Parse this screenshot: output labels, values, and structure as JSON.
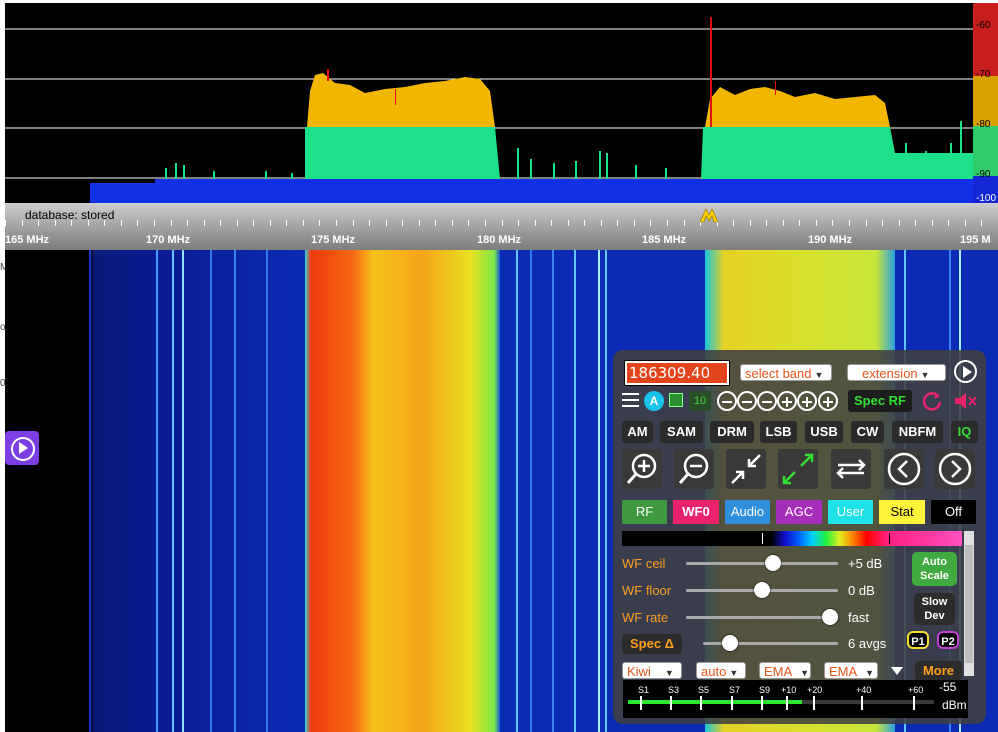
{
  "spectrum": {
    "db_labels": [
      "-60",
      "-70",
      "-80",
      "-90",
      "-100"
    ],
    "db_colors": [
      "#c81e1e",
      "#d8a000",
      "#d8c400",
      "#2ecc6a",
      "#1428d8"
    ]
  },
  "scale": {
    "database_status": "database: stored",
    "freq_labels": [
      "165 MHz",
      "170 MHz",
      "175 MHz",
      "180 MHz",
      "185 MHz",
      "190 MHz",
      "195 M"
    ]
  },
  "left_strip": {
    "glyphs": [
      "M",
      "o",
      "0"
    ]
  },
  "panel": {
    "frequency": "186309.40",
    "band_select": "select band",
    "extension_select": "extension",
    "auto_badge": "A",
    "step_badge": "10",
    "spec_rf": "Spec RF",
    "modes": [
      "AM",
      "SAM",
      "DRM",
      "LSB",
      "USB",
      "CW",
      "NBFM",
      "IQ"
    ],
    "tabs": [
      {
        "label": "RF",
        "color": "#3f9a3f"
      },
      {
        "label": "WF0",
        "color": "#e8236b"
      },
      {
        "label": "Audio",
        "color": "#2f8fdc"
      },
      {
        "label": "AGC",
        "color": "#a52fb8"
      },
      {
        "label": "User",
        "color": "#1fe2e6"
      },
      {
        "label": "Stat",
        "color": "#fff23a"
      },
      {
        "label": "Off",
        "color": "#000000"
      }
    ],
    "sliders": [
      {
        "label": "WF ceil",
        "value": "+5 dB",
        "level": 0.57
      },
      {
        "label": "WF floor",
        "value": "0 dB",
        "level": 0.5
      },
      {
        "label": "WF rate",
        "value": "fast",
        "level": 0.95
      },
      {
        "label": "Spec Δ",
        "value": "6 avgs",
        "level": 0.2
      }
    ],
    "auto_scale": "Auto Scale",
    "slow_dev": "Slow Dev",
    "p1": "P1",
    "p2": "P2",
    "bottom_selects": [
      "Kiwi",
      "auto",
      "EMA",
      "EMA"
    ],
    "more": "More",
    "smeter": {
      "labels": [
        "S1",
        "S3",
        "S5",
        "S7",
        "S9",
        "+10",
        "+20",
        "+40",
        "+60"
      ],
      "reading": "-55",
      "unit": "dBm",
      "level": 0.57
    }
  }
}
